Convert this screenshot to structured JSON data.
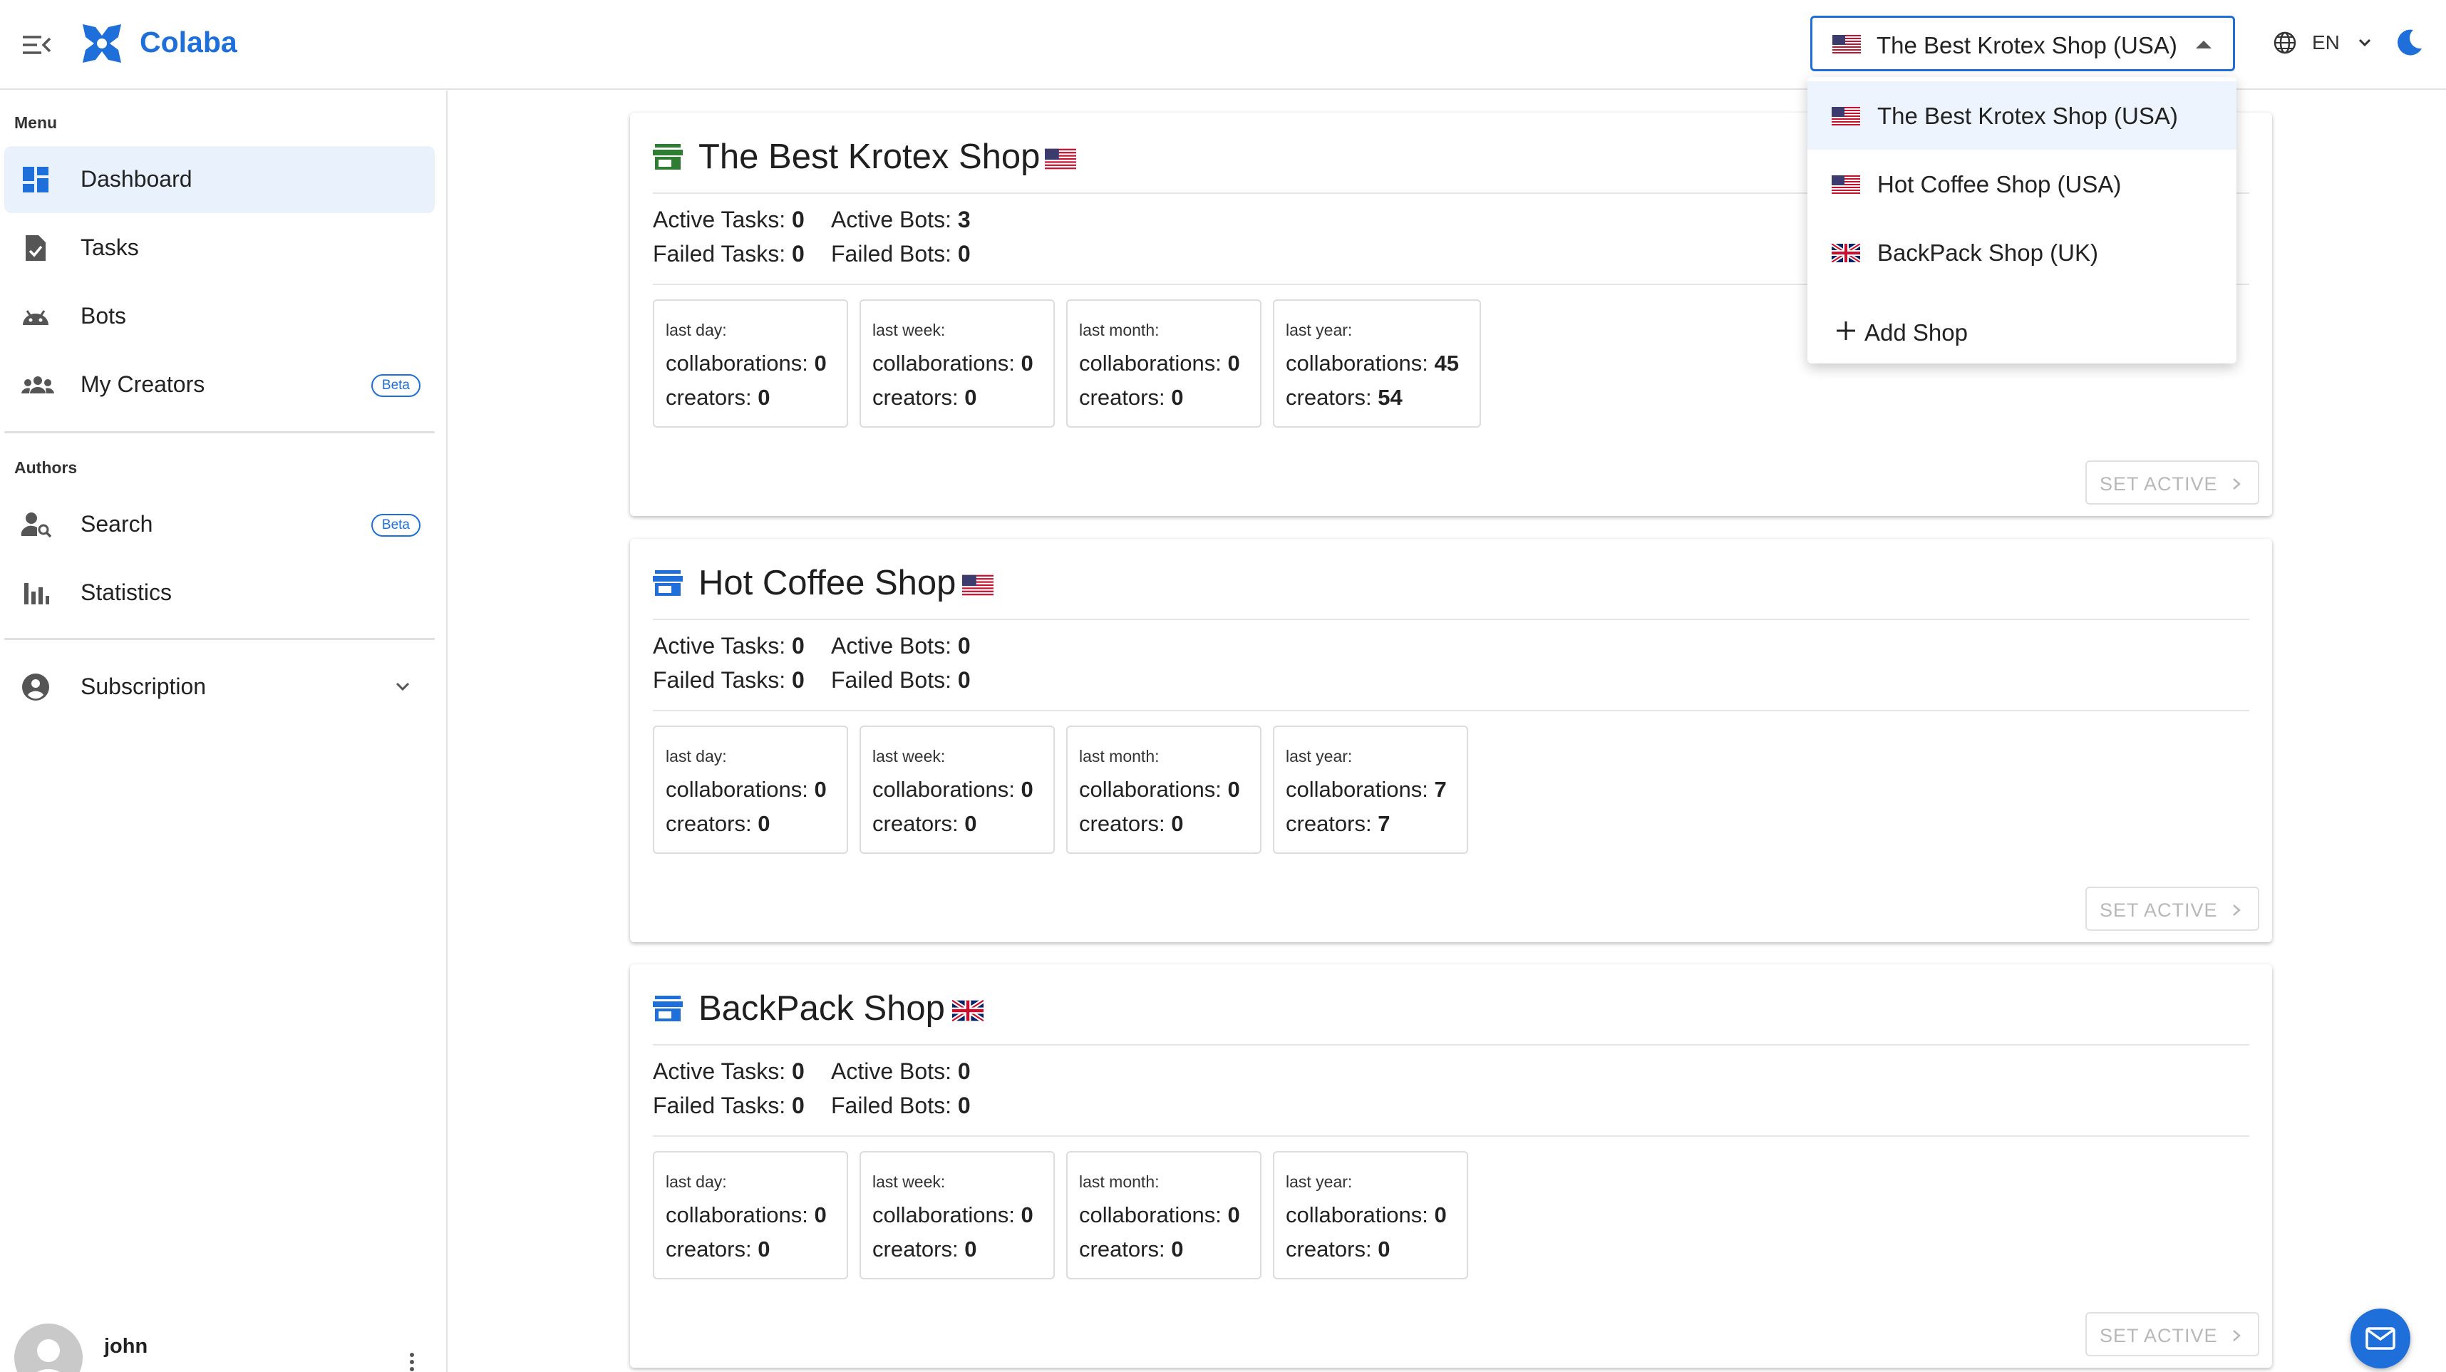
{
  "header": {
    "brand": "Colaba",
    "selected_shop": "The Best Krotex Shop (USA)",
    "language": "EN"
  },
  "sidebar": {
    "menu_title": "Menu",
    "menu_items": [
      {
        "label": "Dashboard",
        "icon": "dashboard-icon",
        "active": true
      },
      {
        "label": "Tasks",
        "icon": "task-icon"
      },
      {
        "label": "Bots",
        "icon": "android-icon"
      },
      {
        "label": "My Creators",
        "icon": "group-icon",
        "badge": "Beta"
      }
    ],
    "authors_title": "Authors",
    "author_items": [
      {
        "label": "Search",
        "icon": "person-search-icon",
        "badge": "Beta"
      },
      {
        "label": "Statistics",
        "icon": "bar-chart-icon"
      }
    ],
    "subscription": {
      "label": "Subscription",
      "icon": "account-circle-icon"
    },
    "user": {
      "name": "john"
    }
  },
  "shops": [
    {
      "name": "The Best Krotex Shop",
      "flag": "us",
      "icon_color": "#2e7d32",
      "active_tasks_label": "Active Tasks:",
      "active_tasks": "0",
      "active_bots_label": "Active Bots:",
      "active_bots": "3",
      "failed_tasks_label": "Failed Tasks:",
      "failed_tasks": "0",
      "failed_bots_label": "Failed Bots:",
      "failed_bots": "0",
      "periods": [
        {
          "label": "last day:",
          "collab_label": "collaborations:",
          "collaborations": "0",
          "creators_label": "creators:",
          "creators": "0"
        },
        {
          "label": "last week:",
          "collab_label": "collaborations:",
          "collaborations": "0",
          "creators_label": "creators:",
          "creators": "0"
        },
        {
          "label": "last month:",
          "collab_label": "collaborations:",
          "collaborations": "0",
          "creators_label": "creators:",
          "creators": "0"
        },
        {
          "label": "last year:",
          "collab_label": "collaborations:",
          "collaborations": "45",
          "creators_label": "creators:",
          "creators": "54"
        }
      ],
      "set_active": "SET ACTIVE"
    },
    {
      "name": "Hot Coffee Shop",
      "flag": "us",
      "icon_color": "#1e6fd9",
      "active_tasks_label": "Active Tasks:",
      "active_tasks": "0",
      "active_bots_label": "Active Bots:",
      "active_bots": "0",
      "failed_tasks_label": "Failed Tasks:",
      "failed_tasks": "0",
      "failed_bots_label": "Failed Bots:",
      "failed_bots": "0",
      "periods": [
        {
          "label": "last day:",
          "collab_label": "collaborations:",
          "collaborations": "0",
          "creators_label": "creators:",
          "creators": "0"
        },
        {
          "label": "last week:",
          "collab_label": "collaborations:",
          "collaborations": "0",
          "creators_label": "creators:",
          "creators": "0"
        },
        {
          "label": "last month:",
          "collab_label": "collaborations:",
          "collaborations": "0",
          "creators_label": "creators:",
          "creators": "0"
        },
        {
          "label": "last year:",
          "collab_label": "collaborations:",
          "collaborations": "7",
          "creators_label": "creators:",
          "creators": "7"
        }
      ],
      "set_active": "SET ACTIVE"
    },
    {
      "name": "BackPack Shop",
      "flag": "uk",
      "icon_color": "#1e6fd9",
      "active_tasks_label": "Active Tasks:",
      "active_tasks": "0",
      "active_bots_label": "Active Bots:",
      "active_bots": "0",
      "failed_tasks_label": "Failed Tasks:",
      "failed_tasks": "0",
      "failed_bots_label": "Failed Bots:",
      "failed_bots": "0",
      "periods": [
        {
          "label": "last day:",
          "collab_label": "collaborations:",
          "collaborations": "0",
          "creators_label": "creators:",
          "creators": "0"
        },
        {
          "label": "last week:",
          "collab_label": "collaborations:",
          "collaborations": "0",
          "creators_label": "creators:",
          "creators": "0"
        },
        {
          "label": "last month:",
          "collab_label": "collaborations:",
          "collaborations": "0",
          "creators_label": "creators:",
          "creators": "0"
        },
        {
          "label": "last year:",
          "collab_label": "collaborations:",
          "collaborations": "0",
          "creators_label": "creators:",
          "creators": "0"
        }
      ],
      "set_active": "SET ACTIVE"
    }
  ],
  "dropdown": {
    "options": [
      {
        "label": "The Best Krotex Shop (USA)",
        "flag": "us",
        "selected": true
      },
      {
        "label": "Hot Coffee Shop (USA)",
        "flag": "us"
      },
      {
        "label": "BackPack Shop (UK)",
        "flag": "uk"
      }
    ],
    "add_label": "Add Shop"
  },
  "colors": {
    "accent": "#1e6fd9",
    "active_nav_bg": "#e9f1fd"
  }
}
